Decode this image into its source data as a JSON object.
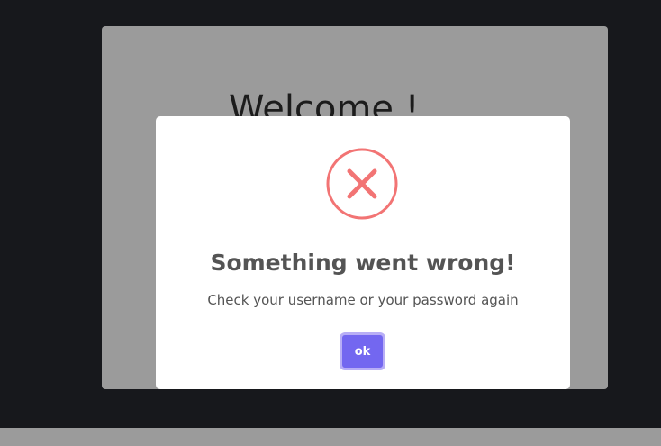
{
  "page": {
    "welcome_heading": "Welcome !"
  },
  "dialog": {
    "icon": "error-x-icon",
    "title": "Something went wrong!",
    "message": "Check your username or your password again",
    "ok_label": "ok"
  },
  "colors": {
    "backdrop": "#17181c",
    "overlay_card": "#9b9b9b",
    "dialog_bg": "#ffffff",
    "error_icon": "#f27474",
    "text": "#545454",
    "button": "#7367f0",
    "button_focus_ring": "#b8aef6"
  }
}
